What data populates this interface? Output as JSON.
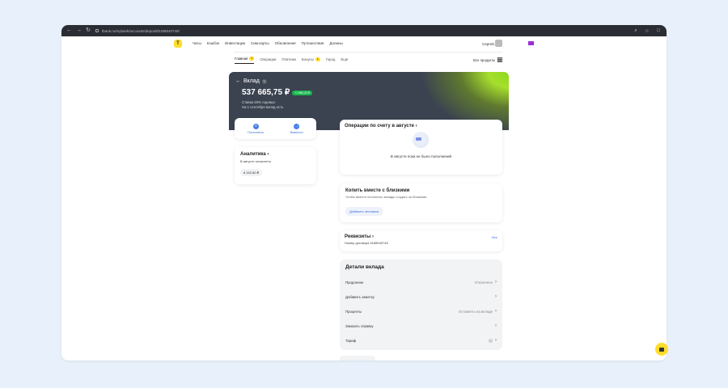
{
  "browser": {
    "url": "tbank.ru/mybank/accounts/deposit/5188540748/"
  },
  "header": {
    "logo": "Т",
    "nav": [
      "Чаты",
      "Кэшбэк",
      "Инвестиции",
      "Сим-карты",
      "Обновления",
      "Путешествия",
      "Долины"
    ],
    "signin": "Сергей"
  },
  "tabs": [
    {
      "label": "Главная",
      "badge": "1"
    },
    {
      "label": "Операции",
      "badge": ""
    },
    {
      "label": "Платежи",
      "badge": ""
    },
    {
      "label": "Бонусы",
      "badge": "1"
    },
    {
      "label": "Город",
      "badge": ""
    },
    {
      "label": "Ещё",
      "badge": ""
    }
  ],
  "all_products": "Все продукты",
  "deposit": {
    "back_title": "Вклад",
    "amount": "537 665,75 ₽",
    "chip": "+1 580,23 ₽",
    "sub1": "Ставка 20% годовых",
    "sub2": "На 1 сентября вклад есть"
  },
  "actions": [
    {
      "label": "Пополнить",
      "icon": "plus-icon"
    },
    {
      "label": "Вывести",
      "icon": "arrow-icon"
    }
  ],
  "analytics": {
    "title": "Аналитика",
    "sub": "В августе зачислено",
    "value": "8 152,80 ₽"
  },
  "operations": {
    "title": "Операции по счету в августе",
    "empty": "В августе пока не было пополнений"
  },
  "save_together": {
    "title": "Копить вместе с близкими",
    "sub": "Чтобы вместе пополнять вклады создать за близкими",
    "button": "Добавить человека"
  },
  "requisites": {
    "title": "Реквизиты",
    "sub": "Номер договора 5188540748",
    "all": "Все"
  },
  "details": {
    "title": "Детали вклада",
    "rows": [
      {
        "label": "Продление",
        "value": "Отключено"
      },
      {
        "label": "Добавить заметку",
        "value": ""
      },
      {
        "label": "Проценты",
        "value": "Оставлять на вкладе"
      },
      {
        "label": "Заказать справку",
        "value": ""
      },
      {
        "label": "Тариф",
        "value": "?"
      }
    ]
  },
  "colors": {
    "accent": "#ffdd2d",
    "link": "#3c6fd8",
    "hero_dark": "#3b4350",
    "hero_green": "#a6df2b"
  }
}
